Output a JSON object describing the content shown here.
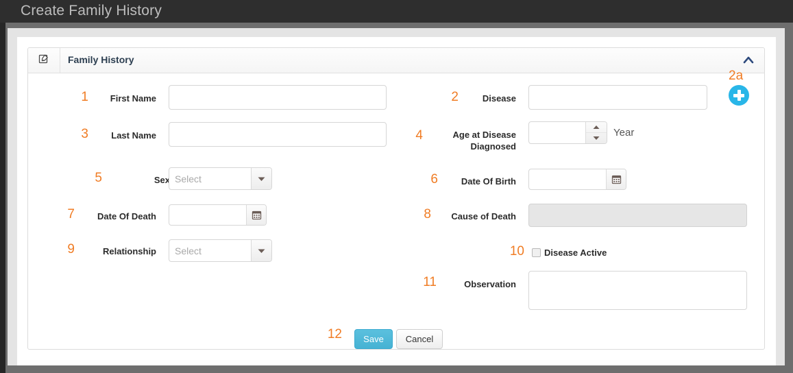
{
  "window": {
    "title": "Create Family History"
  },
  "panel": {
    "title": "Family History",
    "edit_icon": "edit-pencil-icon",
    "collapse_icon": "chevron-up-icon"
  },
  "fields": {
    "first_name": {
      "num": "1",
      "label": "First Name",
      "value": "",
      "placeholder": ""
    },
    "disease": {
      "num": "2",
      "label": "Disease",
      "value": "",
      "placeholder": ""
    },
    "last_name": {
      "num": "3",
      "label": "Last Name",
      "value": "",
      "placeholder": ""
    },
    "age_at_diagnosis": {
      "num": "4",
      "label": "Age at Disease Diagnosed",
      "value": "",
      "unit": "Year"
    },
    "sex": {
      "num": "5",
      "label": "Sex",
      "value": "Select"
    },
    "date_of_birth": {
      "num": "6",
      "label": "Date Of Birth",
      "value": "",
      "icon": "calendar-icon"
    },
    "date_of_death": {
      "num": "7",
      "label": "Date Of Death",
      "value": "",
      "icon": "calendar-icon"
    },
    "cause_of_death": {
      "num": "8",
      "label": "Cause of Death",
      "value": "",
      "disabled": true
    },
    "relationship": {
      "num": "9",
      "label": "Relationship",
      "value": "Select"
    },
    "disease_active": {
      "num": "10",
      "label": "Disease Active",
      "checked": false
    },
    "observation": {
      "num": "11",
      "label": "Observation",
      "value": "",
      "placeholder": ""
    }
  },
  "actions": {
    "num": "12",
    "save_label": "Save",
    "cancel_label": "Cancel"
  },
  "add_disease": {
    "num": "2a",
    "icon": "plus-circle-icon"
  },
  "colors": {
    "accent_number": "#f07c24",
    "save_button": "#46b2d3",
    "add_button": "#29b6e8",
    "titlebar": "#2e2e2e",
    "desktop": "#6e6e6e"
  }
}
